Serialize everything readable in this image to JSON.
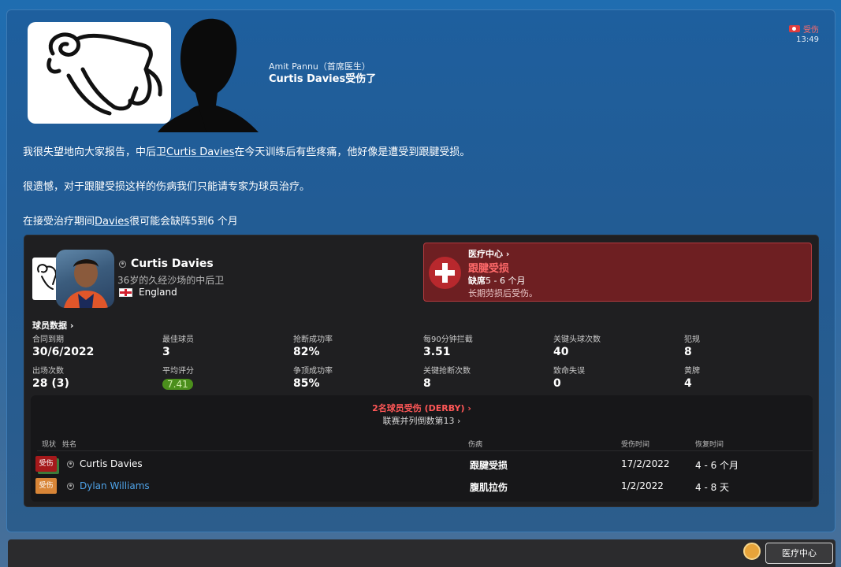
{
  "header": {
    "sender": "Amit Pannu（首席医生）",
    "subject": "Curtis Davies受伤了",
    "tag_label": "受伤",
    "time": "13:49"
  },
  "message": {
    "p1_before": "我很失望地向大家报告，中后卫",
    "p1_link": "Curtis Davies",
    "p1_after": "在今天训练后有些疼痛，他好像是遭受到跟腱受损。",
    "p2": "很遗憾，对于跟腱受损这样的伤病我们只能请专家为球员治疗。",
    "p3_before": "在接受治疗期间",
    "p3_link": "Davies",
    "p3_after": "很可能会缺阵5到6 个月"
  },
  "player": {
    "name": "Curtis Davies",
    "description": "36岁的久经沙场的中后卫",
    "nation": "England"
  },
  "injury": {
    "title": "医疗中心 ›",
    "name": "跟腱受损",
    "duration_label": "缺席",
    "duration_value": "5 - 6 个月",
    "note": "长期劳损后受伤。"
  },
  "stats": {
    "title": "球员数据 ›",
    "items": [
      {
        "label": "合同到期",
        "value": "30/6/2022"
      },
      {
        "label": "最佳球员",
        "value": "3"
      },
      {
        "label": "抢断成功率",
        "value": "82%"
      },
      {
        "label": "每90分钟拦截",
        "value": "3.51"
      },
      {
        "label": "关键头球次数",
        "value": "40"
      },
      {
        "label": "犯规",
        "value": "8"
      },
      {
        "label": "出场次数",
        "value": "28 (3)"
      },
      {
        "label": "平均评分",
        "value": "7.41"
      },
      {
        "label": "争顶成功率",
        "value": "85%"
      },
      {
        "label": "关键抢断次数",
        "value": "8"
      },
      {
        "label": "致命失误",
        "value": "0"
      },
      {
        "label": "黄牌",
        "value": "4"
      }
    ]
  },
  "injury_table": {
    "title": "2名球员受伤 (DERBY) ›",
    "subtitle": "联赛并列倒数第13 ›",
    "columns": {
      "status": "现状",
      "name": "姓名",
      "injury": "伤病",
      "date": "受伤时间",
      "recovery": "恢复时间"
    },
    "rows": [
      {
        "badge": "受伤",
        "name": "Curtis Davies",
        "injury": "跟腱受损",
        "date": "17/2/2022",
        "recovery": "4 - 6 个月"
      },
      {
        "badge": "受伤",
        "name": "Dylan Williams",
        "injury": "腹肌拉伤",
        "date": "1/2/2022",
        "recovery": "4 - 8 天"
      }
    ]
  },
  "footer": {
    "medical_button": "医疗中心"
  },
  "colors": {
    "injury_red": "#ff6a6a",
    "link_blue": "#4fa3e8",
    "rating_green": "#4b8f1c"
  }
}
